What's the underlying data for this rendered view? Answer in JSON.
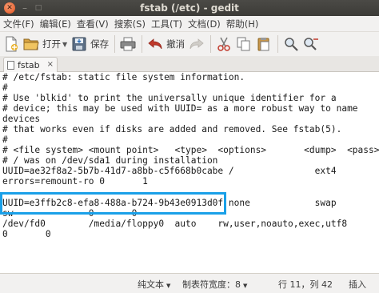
{
  "window": {
    "title": "fstab (/etc) - gedit",
    "close_glyph": "✕",
    "min_glyph": "–",
    "max_glyph": "□"
  },
  "menubar": {
    "items": [
      "文件(F)",
      "编辑(E)",
      "查看(V)",
      "搜索(S)",
      "工具(T)",
      "文档(D)",
      "帮助(H)"
    ]
  },
  "toolbar": {
    "open_label": "打开",
    "save_label": "保存",
    "undo_label": "撤消"
  },
  "tab": {
    "name": "fstab",
    "close_glyph": "×"
  },
  "editor": {
    "lines": [
      "# /etc/fstab: static file system information.",
      "#",
      "# Use 'blkid' to print the universally unique identifier for a",
      "# device; this may be used with UUID= as a more robust way to name",
      "devices",
      "# that works even if disks are added and removed. See fstab(5).",
      "#",
      "# <file system> <mount point>   <type>  <options>       <dump>  <pass>",
      "# / was on /dev/sda1 during installation",
      "UUID=ae32f8a2-5b7b-41d7-a8bb-c5f668b0cabe /               ext4",
      "errors=remount-ro 0       1",
      "UUID=e3ffb2c8-efa8-488a-b724-9b43e0913d0f none            swap",
      "sw              0       0",
      "/dev/fd0        /media/floppy0  auto    rw,user,noauto,exec,utf8",
      "0       0"
    ]
  },
  "status": {
    "encoding": "纯文本",
    "tab_width": "制表符宽度：8",
    "position": "行 11，列 42",
    "mode": "插入"
  },
  "colors": {
    "highlight": "#1aa0e8",
    "close_button": "#e3521e",
    "titlebar": "#3c3b37"
  }
}
